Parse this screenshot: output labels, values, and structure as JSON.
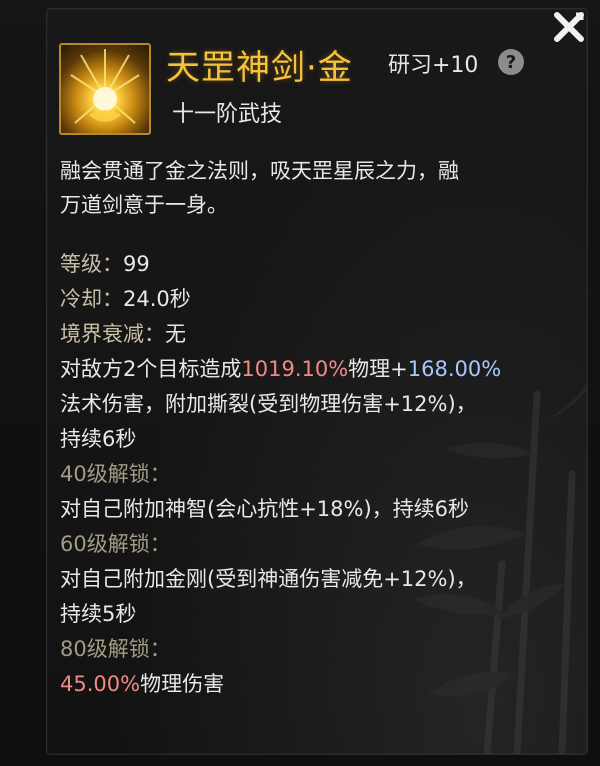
{
  "skill": {
    "title": "天罡神剑·金",
    "research": "研习+10",
    "help_glyph": "?",
    "rank": "十一阶武技",
    "description_line1": "融会贯通了金之法则，吸天罡星辰之力，融",
    "description_line2": "万道剑意于一身。"
  },
  "stats": {
    "level_label": "等级：",
    "level_value": "99",
    "cooldown_label": "冷却：",
    "cooldown_value": "24.0秒",
    "decay_label": "境界衰减：",
    "decay_value": "无"
  },
  "effect": {
    "part1": "对敌方2个目标造成",
    "physical_pct": "1019.10%",
    "part2": "物理+",
    "magic_pct": "168.00%",
    "line2": "法术伤害，附加撕裂(受到物理伤害+12%)，",
    "line3": "持续6秒"
  },
  "unlocks": [
    {
      "header": "40级解锁：",
      "text_lines": [
        "对自己附加神智(会心抗性+18%)，持续6秒"
      ]
    },
    {
      "header": "60级解锁：",
      "text_lines": [
        "对自己附加金刚(受到神通伤害减免+12%)，",
        "持续5秒"
      ]
    },
    {
      "header": "80级解锁：",
      "highlight": "45.00%",
      "text_lines": [
        "物理伤害"
      ]
    }
  ],
  "colors": {
    "title": "#f6c23a",
    "physical": "#f08a84",
    "magic": "#a9c6ff",
    "label": "#c8bfa6"
  },
  "icons": {
    "close": "close-x-icon",
    "help": "question-mark-icon",
    "skill": "golden-sword-skill-icon"
  }
}
